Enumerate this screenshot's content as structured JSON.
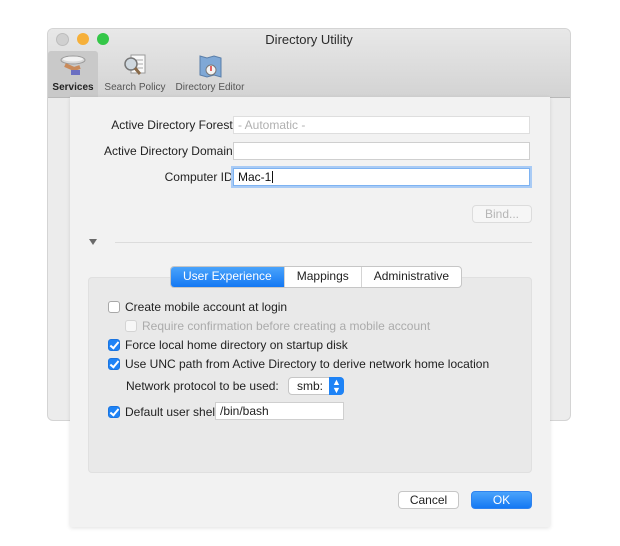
{
  "window": {
    "title": "Directory Utility",
    "toolbar": [
      {
        "label": "Services",
        "icon": "services-icon",
        "active": true
      },
      {
        "label": "Search Policy",
        "icon": "search-policy-icon",
        "active": false
      },
      {
        "label": "Directory Editor",
        "icon": "directory-editor-icon",
        "active": false
      }
    ]
  },
  "sheet": {
    "forest_label": "Active Directory Forest:",
    "forest_placeholder": "- Automatic -",
    "domain_label": "Active Directory Domain:",
    "domain_value": "",
    "computer_id_label": "Computer ID:",
    "computer_id_value": "Mac-1",
    "bind_label": "Bind...",
    "tabs": [
      {
        "label": "User Experience",
        "active": true
      },
      {
        "label": "Mappings",
        "active": false
      },
      {
        "label": "Administrative",
        "active": false
      }
    ],
    "options": {
      "create_mobile": {
        "label": "Create mobile account at login",
        "checked": false
      },
      "require_confirmation": {
        "label": "Require confirmation before creating a mobile account",
        "checked": false,
        "disabled": true
      },
      "force_local_home": {
        "label": "Force local home directory on startup disk",
        "checked": true
      },
      "use_unc": {
        "label": "Use UNC path from Active Directory to derive network home location",
        "checked": true
      },
      "protocol_label": "Network protocol to be used:",
      "protocol_value": "smb:",
      "default_shell": {
        "label": "Default user shell:",
        "checked": true,
        "value": "/bin/bash"
      }
    },
    "cancel_label": "Cancel",
    "ok_label": "OK"
  }
}
